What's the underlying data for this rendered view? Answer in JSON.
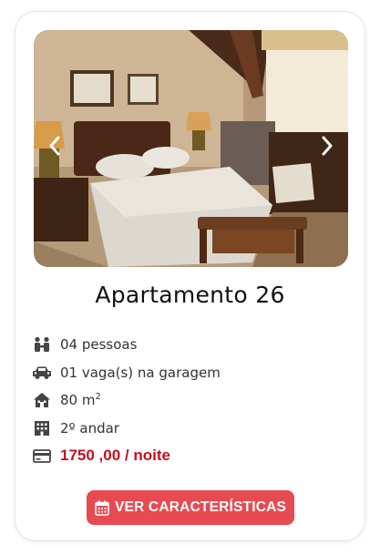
{
  "listing": {
    "title": "Apartamento 26",
    "features": {
      "people": "04 pessoas",
      "parking": "01 vaga(s) na garagem",
      "area": "80 m",
      "area_sup": "2",
      "floor": "2º andar",
      "price": "1750 ,00 / noite"
    },
    "cta_label": "VER CARACTERÍSTICAS"
  },
  "colors": {
    "price": "#c0111f",
    "cta_background": "#e84a52"
  }
}
